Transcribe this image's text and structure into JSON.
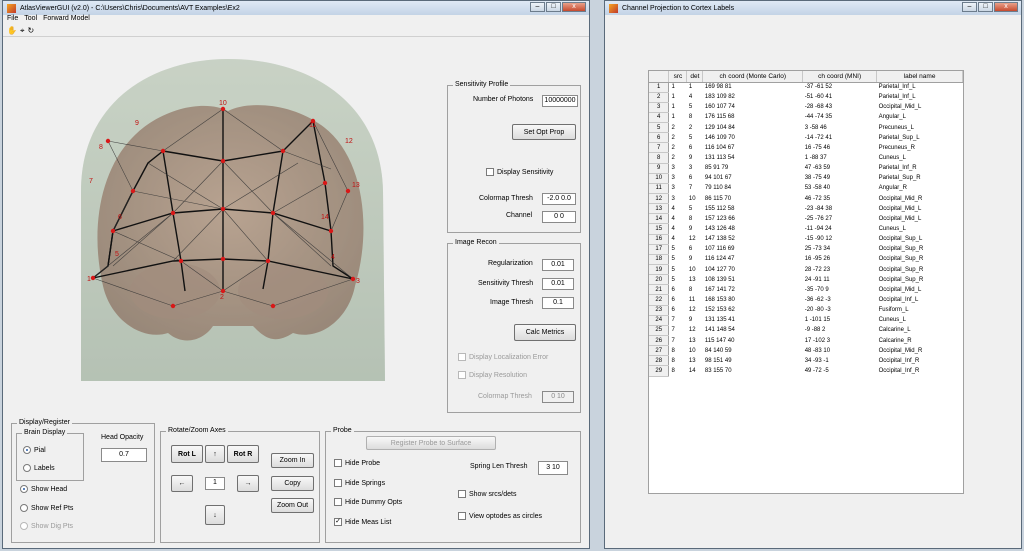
{
  "left_window": {
    "title": "AtlasViewerGUI  (v2.0) - C:\\Users\\Chris\\Documents\\AVT Examples\\Ex2",
    "menu": [
      "File",
      "Tool",
      "Forward Model"
    ],
    "toolbar_icons": [
      "pan-icon",
      "data-cursor-icon",
      "rotate-icon"
    ],
    "sensitivity_profile": {
      "title": "Sensitivity Profile",
      "num_photons_label": "Number of Photons",
      "num_photons_value": "10000000",
      "set_opt_prop_label": "Set Opt Prop",
      "display_sensitivity_label": "Display Sensitivity",
      "colormap_thresh_label": "Colormap Thresh",
      "colormap_thresh_value": "-2.0 0.0",
      "channel_label": "Channel",
      "channel_value": "0 0"
    },
    "image_recon": {
      "title": "Image Recon",
      "regularization_label": "Regularization",
      "regularization_value": "0.01",
      "sensitivity_thresh_label": "Sensitivity Thresh",
      "sensitivity_thresh_value": "0.01",
      "image_thresh_label": "Image Thresh",
      "image_thresh_value": "0.1",
      "calc_metrics_label": "Calc Metrics",
      "display_localization_error_label": "Display Localization Error",
      "display_resolution_label": "Display Resolution",
      "colormap_thresh_label": "Colormap Thresh",
      "colormap_thresh_value": "0 10"
    },
    "display_register": {
      "title": "Display/Register",
      "brain_display_title": "Brain Display",
      "pial_label": "Pial",
      "labels_label": "Labels",
      "head_opacity_label": "Head Opacity",
      "head_opacity_value": "0.7",
      "show_head_label": "Show Head",
      "show_ref_pts_label": "Show Ref Pts",
      "show_dig_pts_label": "Show Dig Pts"
    },
    "rotate_zoom": {
      "title": "Rotate/Zoom Axes",
      "rot_l_label": "Rot L",
      "rot_r_label": "Rot R",
      "up_arrow": "↑",
      "down_arrow": "↓",
      "left_arrow": "←",
      "right_arrow": "→",
      "step_value": "1",
      "zoom_in_label": "Zoom In",
      "copy_label": "Copy",
      "zoom_out_label": "Zoom Out"
    },
    "probe": {
      "title": "Probe",
      "register_probe_label": "Register Probe to Surface",
      "hide_probe_label": "Hide Probe",
      "hide_springs_label": "Hide Springs",
      "hide_dummy_opts_label": "Hide Dummy Opts",
      "hide_meas_list_label": "Hide Meas List",
      "spring_len_thresh_label": "Spring Len Thresh",
      "spring_len_thresh_value": "3 10",
      "show_srcs_dets_label": "Show srcs/dets",
      "view_optodes_circles_label": "View optodes as circles"
    },
    "optode_labels": [
      "10",
      "9",
      "11",
      "8",
      "12",
      "7",
      "13",
      "6",
      "14",
      "5",
      "1",
      "4",
      "2",
      "3"
    ]
  },
  "right_window": {
    "title": "Channel Projection to Cortex Labels",
    "columns": [
      "src",
      "det",
      "ch coord (Monte Carlo)",
      "ch coord (MNI)",
      "label name"
    ],
    "rows": [
      [
        "1",
        "1",
        "1",
        "169  98  81",
        "-37 -61  52",
        "Parietal_Inf_L"
      ],
      [
        "2",
        "1",
        "4",
        "183  109  82",
        "-51 -60  41",
        "Parietal_Inf_L"
      ],
      [
        "3",
        "1",
        "5",
        "160  107  74",
        "-28 -68  43",
        "Occipital_Mid_L"
      ],
      [
        "4",
        "1",
        "8",
        "176  115  68",
        "-44 -74  35",
        "Angular_L"
      ],
      [
        "5",
        "2",
        "2",
        "129  104  84",
        "3 -58  46",
        "Precuneus_L"
      ],
      [
        "6",
        "2",
        "5",
        "146  109  70",
        "-14 -72  41",
        "Parietal_Sup_L"
      ],
      [
        "7",
        "2",
        "6",
        "116  104  67",
        "16 -75  46",
        "Precuneus_R"
      ],
      [
        "8",
        "2",
        "9",
        "131  113  54",
        "1 -88  37",
        "Cuneus_L"
      ],
      [
        "9",
        "3",
        "3",
        "85  91  79",
        "47 -63  59",
        "Parietal_Inf_R"
      ],
      [
        "10",
        "3",
        "6",
        "94  101  67",
        "38 -75  49",
        "Parietal_Sup_R"
      ],
      [
        "11",
        "3",
        "7",
        "79  110  84",
        "53 -58  40",
        "Angular_R"
      ],
      [
        "12",
        "3",
        "10",
        "86  115  70",
        "46 -72  35",
        "Occipital_Mid_R"
      ],
      [
        "13",
        "4",
        "5",
        "155  112  58",
        "-23 -84  38",
        "Occipital_Mid_L"
      ],
      [
        "14",
        "4",
        "8",
        "157  123  66",
        "-25 -76  27",
        "Occipital_Mid_L"
      ],
      [
        "15",
        "4",
        "9",
        "143  126  48",
        "-11 -94  24",
        "Cuneus_L"
      ],
      [
        "16",
        "4",
        "12",
        "147  138  52",
        "-15 -90  12",
        "Occipital_Sup_L"
      ],
      [
        "17",
        "5",
        "6",
        "107  116  69",
        "25 -73  34",
        "Occipital_Sup_R"
      ],
      [
        "18",
        "5",
        "9",
        "116  124  47",
        "16 -95  26",
        "Occipital_Sup_R"
      ],
      [
        "19",
        "5",
        "10",
        "104  127  70",
        "28 -72  23",
        "Occipital_Sup_R"
      ],
      [
        "20",
        "5",
        "13",
        "108  139  51",
        "24 -91  11",
        "Occipital_Sup_R"
      ],
      [
        "21",
        "6",
        "8",
        "167  141  72",
        "-35 -70  9",
        "Occipital_Mid_L"
      ],
      [
        "22",
        "6",
        "11",
        "168  153  80",
        "-36 -62  -3",
        "Occipital_Inf_L"
      ],
      [
        "23",
        "6",
        "12",
        "152  153  62",
        "-20 -80  -3",
        "Fusiform_L"
      ],
      [
        "24",
        "7",
        "9",
        "131  135  41",
        "1 -101  15",
        "Cuneus_L"
      ],
      [
        "25",
        "7",
        "12",
        "141  148  54",
        "-9 -88  2",
        "Calcarine_L"
      ],
      [
        "26",
        "7",
        "13",
        "115  147  40",
        "17 -102  3",
        "Calcarine_R"
      ],
      [
        "27",
        "8",
        "10",
        "84  140  59",
        "48 -83  10",
        "Occipital_Mid_R"
      ],
      [
        "28",
        "8",
        "13",
        "98  151  49",
        "34 -93  -1",
        "Occipital_Inf_R"
      ],
      [
        "29",
        "8",
        "14",
        "83  155  70",
        "49 -72  -5",
        "Occipital_Inf_R"
      ]
    ]
  },
  "colors": {
    "brain": "#9c7462",
    "head": "#bcc8b4",
    "optode": "#d81818",
    "mesh_line": "#111111"
  }
}
